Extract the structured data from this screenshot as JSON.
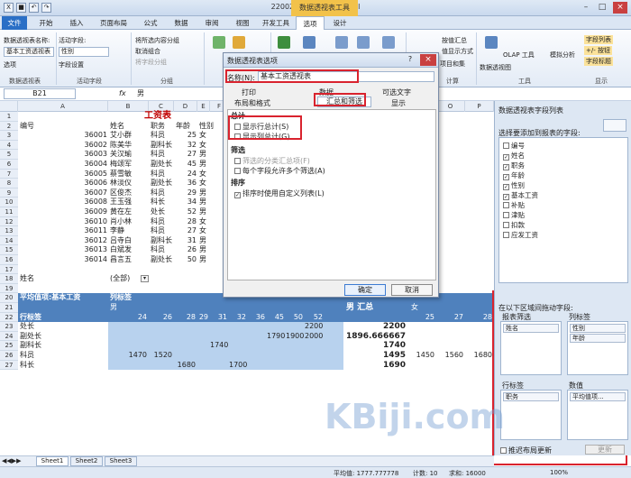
{
  "app": {
    "title": "220025 - Microsoft Excel",
    "context_tab_title": "数据透视表工具"
  },
  "tabs": [
    "文件",
    "开始",
    "插入",
    "页面布局",
    "公式",
    "数据",
    "审阅",
    "视图",
    "开发工具",
    "选项",
    "设计"
  ],
  "ribbon": {
    "pivot_name_label": "数据透视表名称:",
    "pivot_name_value": "基本工资透视表",
    "options_label": "选项",
    "active_field_label": "活动字段:",
    "active_field_value": "性别",
    "field_settings": "字段设置",
    "group_selection": "将所选内容分组",
    "ungroup": "取消组合",
    "group_field": "将字段分组",
    "refresh": "刷新",
    "change_source": "更改数据源",
    "clear": "清除",
    "select": "选择",
    "move": "移动数据透视表",
    "summarize": "按值汇总",
    "show_as": "值显示方式",
    "fields_items": "项目和集",
    "pivot_chart": "数据透视图",
    "olap_tools": "OLAP 工具",
    "what_if": "模拟分析",
    "field_list": "字段列表",
    "plus_minus": "+/- 按钮",
    "field_headers": "字段标题",
    "groups": [
      "数据透视表",
      "活动字段",
      "分组",
      "数据",
      "计算",
      "工具",
      "显示"
    ]
  },
  "formula_bar": {
    "name_box": "B21",
    "fx": "fx",
    "value": "男"
  },
  "columns": [
    "A",
    "B",
    "C",
    "D",
    "E",
    "F",
    "G",
    "H",
    "I",
    "J",
    "K",
    "L",
    "M",
    "N",
    "O",
    "P",
    "Q",
    "R"
  ],
  "rows": [
    "1",
    "2",
    "3",
    "4",
    "5",
    "6",
    "7",
    "8",
    "9",
    "10",
    "11",
    "12",
    "13",
    "14",
    "15",
    "16",
    "17",
    "18",
    "19",
    "20",
    "21",
    "22",
    "23",
    "24",
    "25",
    "26",
    "27"
  ],
  "sheet": {
    "title": "工资表",
    "headers": [
      "编号",
      "姓名",
      "职务",
      "年龄",
      "性别"
    ],
    "employees": [
      [
        "36001",
        "艾小群",
        "科员",
        "25",
        "女"
      ],
      [
        "36002",
        "陈美华",
        "副科长",
        "32",
        "女"
      ],
      [
        "36003",
        "关汉瑜",
        "科员",
        "27",
        "男"
      ],
      [
        "36004",
        "梅颂军",
        "副处长",
        "45",
        "男"
      ],
      [
        "36005",
        "蔡雪敏",
        "科员",
        "24",
        "女"
      ],
      [
        "36006",
        "林淡仪",
        "副处长",
        "36",
        "女"
      ],
      [
        "36007",
        "区俊杰",
        "科员",
        "29",
        "男"
      ],
      [
        "36008",
        "王玉强",
        "科长",
        "34",
        "男"
      ],
      [
        "36009",
        "黄在左",
        "处长",
        "52",
        "男"
      ],
      [
        "36010",
        "肖小林",
        "科员",
        "28",
        "女"
      ],
      [
        "36011",
        "李静",
        "科员",
        "27",
        "女"
      ],
      [
        "36012",
        "吕寺白",
        "副科长",
        "31",
        "男"
      ],
      [
        "36013",
        "白斌发",
        "科员",
        "26",
        "男"
      ],
      [
        "36014",
        "昌言五",
        "副处长",
        "50",
        "男"
      ]
    ],
    "filter_label": "姓名",
    "filter_value": "(全部)",
    "pivot_value_label": "平均值项:基本工资",
    "col_label": "列标签",
    "row_label": "行标签",
    "group_male": "男",
    "group_female": "女",
    "male_total": "男 汇总",
    "ages_m": [
      "24",
      "26",
      "28",
      "29",
      "31",
      "32",
      "36",
      "45",
      "50",
      "52"
    ],
    "ages_f": [
      "25",
      "27",
      "28"
    ],
    "pivot_rows": [
      {
        "label": "处长",
        "vals": [
          "",
          "",
          "",
          "",
          "",
          "",
          "",
          "",
          "",
          "2200"
        ],
        "total": "2200",
        "f": [
          "",
          "",
          ""
        ]
      },
      {
        "label": "副处长",
        "vals": [
          "",
          "",
          "",
          "",
          "",
          "",
          "",
          "1790",
          "1900",
          "2000"
        ],
        "total": "1896.666667",
        "f": [
          "",
          "",
          ""
        ]
      },
      {
        "label": "副科长",
        "vals": [
          "",
          "",
          "",
          "",
          "1740",
          "",
          "",
          "",
          "",
          ""
        ],
        "total": "1740",
        "f": [
          "",
          "",
          ""
        ]
      },
      {
        "label": "科员",
        "vals": [
          "1470",
          "1520",
          "",
          "",
          "",
          "",
          "",
          "",
          "",
          ""
        ],
        "total": "1495",
        "f": [
          "1450",
          "1560",
          "1680"
        ]
      },
      {
        "label": "科长",
        "vals": [
          "",
          "",
          "1680",
          "",
          "",
          "1700",
          "",
          "",
          "",
          ""
        ],
        "total": "1690",
        "f": [
          "",
          "",
          ""
        ]
      }
    ]
  },
  "dialog": {
    "title": "数据透视表选项",
    "help": "?",
    "close": "×",
    "name_label": "名称(N):",
    "name_value": "基本工资透视表",
    "tabs_top": [
      "打印",
      "数据",
      "可选文字"
    ],
    "tabs_bottom": [
      "布局和格式",
      "汇总和筛选",
      "显示"
    ],
    "section_total": "总计",
    "show_row_total": "显示行总计(S)",
    "show_col_total": "显示列总计(G)",
    "section_filter": "筛选",
    "filter_subtotal": "筛选的分类汇总项(F)",
    "filter_multi": "每个字段允许多个筛选(A)",
    "section_sort": "排序",
    "sort_custom": "排序时使用自定义列表(L)",
    "ok": "确定",
    "cancel": "取消"
  },
  "panel": {
    "title": "数据透视表字段列表",
    "choose_label": "选择要添加到报表的字段:",
    "fields": [
      {
        "name": "编号",
        "checked": false
      },
      {
        "name": "姓名",
        "checked": true
      },
      {
        "name": "职务",
        "checked": true
      },
      {
        "name": "年龄",
        "checked": true
      },
      {
        "name": "性别",
        "checked": true
      },
      {
        "name": "基本工资",
        "checked": true
      },
      {
        "name": "补贴",
        "checked": false
      },
      {
        "name": "津贴",
        "checked": false
      },
      {
        "name": "扣款",
        "checked": false
      },
      {
        "name": "应发工资",
        "checked": false
      }
    ],
    "drag_label": "在以下区域间拖动字段:",
    "report_filter": "报表筛选",
    "column_labels": "列标签",
    "row_labels": "行标签",
    "values": "数值",
    "filter_item": "姓名",
    "col_items": [
      "性别",
      "年龄"
    ],
    "row_item": "职务",
    "value_item": "平均值项...",
    "defer": "推迟布局更新",
    "update": "更新"
  },
  "sheet_tabs": [
    "Sheet1",
    "Sheet2",
    "Sheet3"
  ],
  "status": {
    "average": "平均值: 1777.777778",
    "count": "计数: 10",
    "sum": "求和: 16000",
    "zoom": "100%"
  },
  "watermark": "KBiji.com",
  "colors": {
    "accent": "#2a6fc6",
    "highlight": "#d9232e",
    "pivot_header": "#4f81bd",
    "pivot_fill": "#b8d2ee"
  }
}
